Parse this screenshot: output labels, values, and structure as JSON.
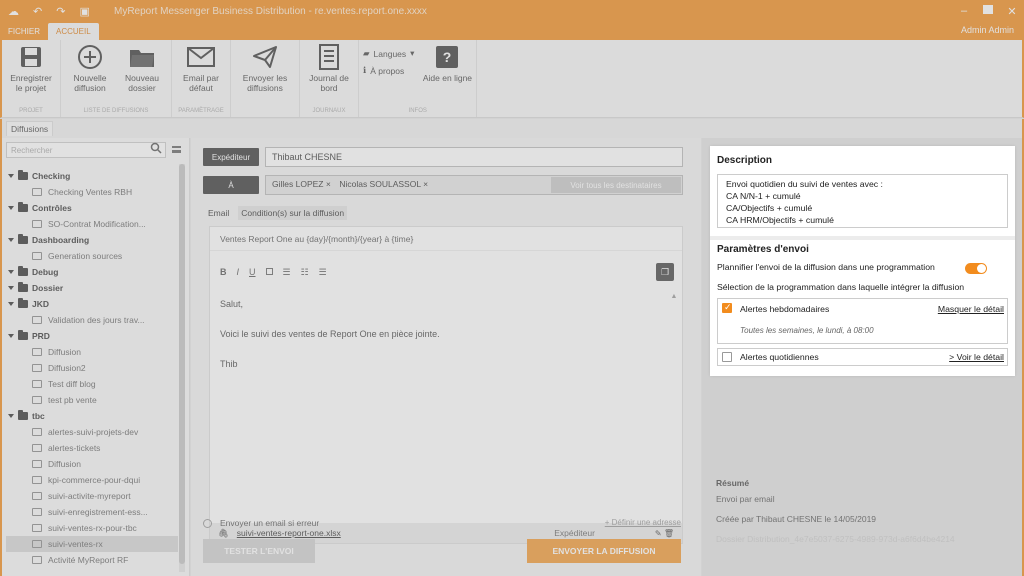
{
  "window": {
    "title": "MyReport Messenger Business Distribution - re.ventes.report.one.xxxx",
    "admin_label": "Admin Admin"
  },
  "ribbon_tabs": [
    "FICHIER",
    "ACCUEIL"
  ],
  "ribbon": {
    "groups": [
      {
        "name": "PROJET",
        "buttons": [
          "Enregistrer le projet"
        ]
      },
      {
        "name": "LISTE DE DIFFUSIONS",
        "buttons": [
          "Nouvelle diffusion",
          "Nouveau dossier"
        ]
      },
      {
        "name": "PARAMÈTRAGE",
        "buttons": [
          "Email par défaut"
        ]
      },
      {
        "name": "",
        "buttons": [
          "Envoyer les diffusions"
        ]
      },
      {
        "name": "JOURNAUX",
        "buttons": [
          "Journal de bord"
        ]
      },
      {
        "name": "INFOS",
        "small": [
          "Langues",
          "À propos"
        ],
        "buttons": [
          "Aide en ligne"
        ]
      }
    ]
  },
  "doc_tab": "Diffusions",
  "tree": {
    "search_placeholder": "Rechercher",
    "rows": [
      {
        "type": "folder",
        "label": "Checking"
      },
      {
        "type": "item",
        "label": "Checking Ventes RBH"
      },
      {
        "type": "folder",
        "label": "Contrôles"
      },
      {
        "type": "item",
        "label": "SO-Contrat Modification..."
      },
      {
        "type": "folder",
        "label": "Dashboarding"
      },
      {
        "type": "item",
        "label": "Generation sources"
      },
      {
        "type": "folder",
        "label": "Debug"
      },
      {
        "type": "folder",
        "label": "Dossier"
      },
      {
        "type": "folder",
        "label": "JKD"
      },
      {
        "type": "item",
        "label": "Validation des jours trav..."
      },
      {
        "type": "folder",
        "label": "PRD"
      },
      {
        "type": "item",
        "label": "Diffusion"
      },
      {
        "type": "item",
        "label": "Diffusion2"
      },
      {
        "type": "item",
        "label": "Test diff blog"
      },
      {
        "type": "item",
        "label": "test pb vente"
      },
      {
        "type": "folder",
        "label": "tbc"
      },
      {
        "type": "item",
        "label": "alertes-suivi-projets-dev"
      },
      {
        "type": "item",
        "label": "alertes-tickets"
      },
      {
        "type": "item",
        "label": "Diffusion"
      },
      {
        "type": "item",
        "label": "kpi-commerce-pour-dqui"
      },
      {
        "type": "item",
        "label": "suivi-activite-myreport"
      },
      {
        "type": "item",
        "label": "suivi-enregistrement-ess..."
      },
      {
        "type": "item",
        "label": "suivi-ventes-rx-pour-tbc"
      },
      {
        "type": "item",
        "label": "suivi-ventes-rx",
        "selected": true
      },
      {
        "type": "item",
        "label": "Activité MyReport RF"
      }
    ]
  },
  "email": {
    "sender_label": "Expéditeur",
    "sender_value": "Thibaut CHESNE",
    "to_label": "À",
    "recipients": [
      "Gilles LOPEZ ×",
      "Nicolas SOULASSOL ×"
    ],
    "add_recipients": "Voir tous les destinataires",
    "tabs": [
      "Email",
      "Condition(s) sur la diffusion"
    ],
    "subject": "Ventes Report One au {day}/{month}/{year} à {time}",
    "body": [
      "Salut,",
      "Voici le suivi des ventes de Report One en pièce jointe.",
      "Thib"
    ],
    "attachment_name": "suivi-ventes-report-one.xlsx",
    "attachment_role": "Expéditeur",
    "error_option": "Envoyer un email si erreur",
    "error_link": "+ Définir une adresse",
    "test_button": "TESTER L'ENVOI",
    "send_button": "ENVOYER LA DIFFUSION"
  },
  "panel": {
    "description_title": "Description",
    "description_lines": [
      "Envoi quotidien du suivi de ventes avec :",
      "CA N/N-1 + cumulé",
      "CA/Objectifs + cumulé",
      "CA HRM/Objectifs + cumulé"
    ],
    "params_title": "Paramètres d'envoi",
    "plan_label": "Plannifier l'envoi de la diffusion dans une programmation",
    "plan_enabled": true,
    "select_label": "Sélection de la programmation dans laquelle intégrer la diffusion",
    "schedules": [
      {
        "name": "Alertes hebdomadaires",
        "checked": true,
        "link": "Masquer le détail",
        "detail": "Toutes les semaines, le lundi, à 08:00"
      },
      {
        "name": "Alertes quotidiennes",
        "checked": false,
        "link": "> Voir le détail"
      }
    ],
    "summary_title": "Résumé",
    "summary_lines": [
      "Envoi par email",
      "Créée par Thibaut CHESNE le 14/05/2019",
      "Dossier Distribution_4e7e5037-6275-4989-973d-a6f6d4be4214"
    ]
  },
  "colors": {
    "accent": "#f28c1e",
    "toggle_on": "#f28c1e"
  }
}
